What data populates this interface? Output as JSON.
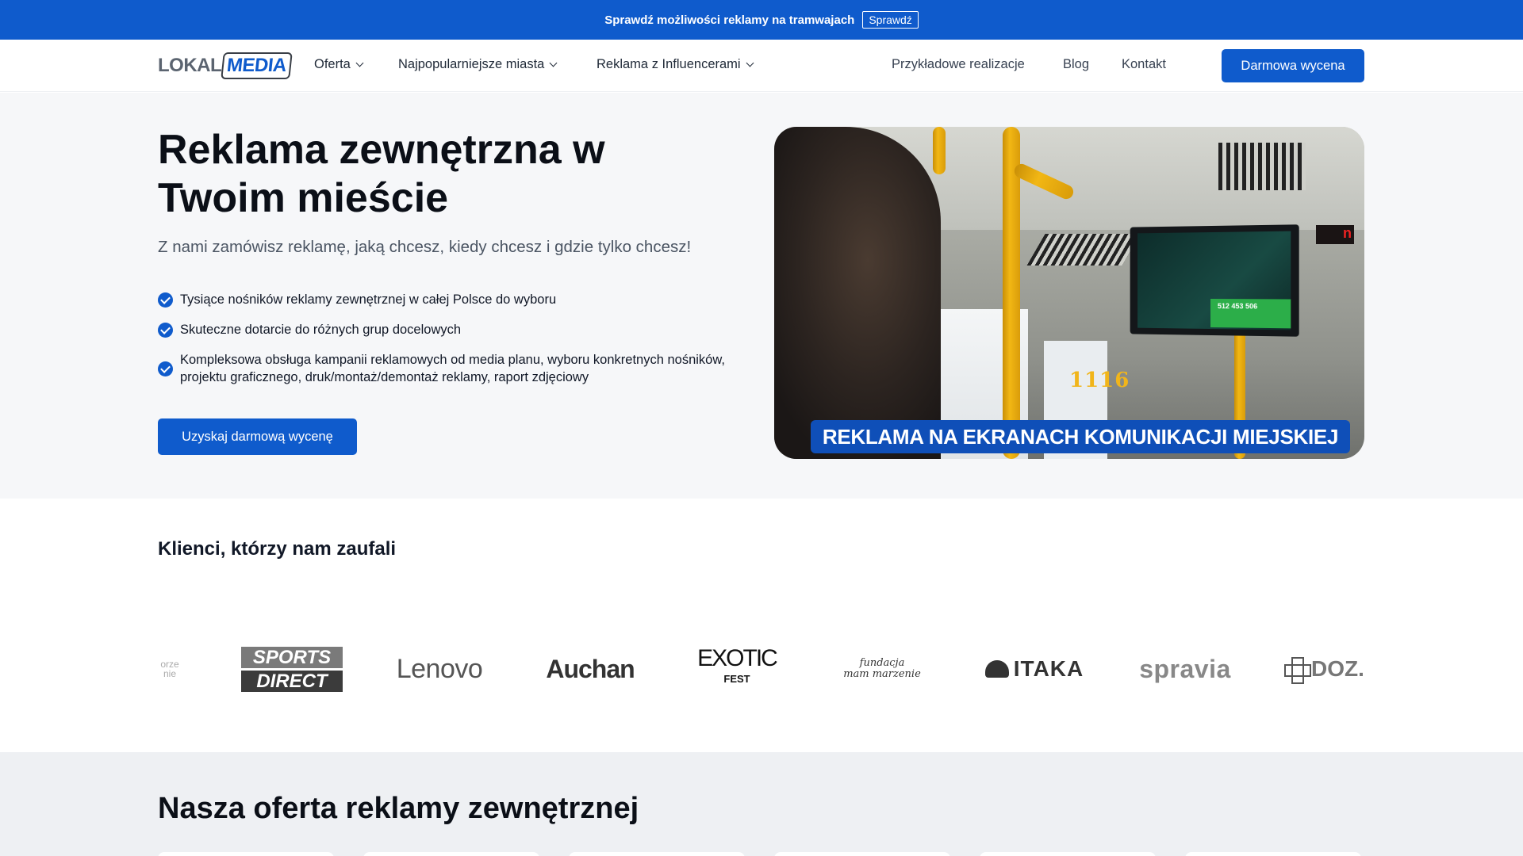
{
  "promo": {
    "text": "Sprawdź możliwości reklamy na tramwajach",
    "button": "Sprawdź"
  },
  "nav": {
    "logo": {
      "part1": "LOKAL",
      "part2": "MEDIA"
    },
    "menus": [
      {
        "label": "Oferta"
      },
      {
        "label": "Najpopularniejsze miasta"
      },
      {
        "label": "Reklama z Influencerami"
      }
    ],
    "links": [
      {
        "label": "Przykładowe realizacje"
      },
      {
        "label": "Blog"
      },
      {
        "label": "Kontakt"
      }
    ],
    "cta": "Darmowa wycena"
  },
  "hero": {
    "title": "Reklama zewnętrzna w Twoim mieście",
    "subtitle": "Z nami zamówisz reklamę, jaką chcesz, kiedy chcesz i gdzie tylko chcesz!",
    "features": [
      "Tysiące nośników reklamy zewnętrznej w całej Polsce do wyboru",
      "Skuteczne dotarcie do różnych grup docelowych",
      "Kompleksowa obsługa kampanii reklamowych od media planu, wyboru konkretnych nośników, projektu graficznego, druk/montaż/demontaż reklamy, raport zdjęciowy"
    ],
    "button": "Uzyskaj darmową wycenę",
    "image": {
      "caption": "REKLAMA NA EKRANACH KOMUNIKACJI MIEJSKIEJ",
      "bus_number": "1116",
      "screen_phone": "512 453 506"
    }
  },
  "clients": {
    "title": "Klienci, którzy nam zaufali",
    "logos": {
      "partial": [
        "orze",
        "nie"
      ],
      "sports_direct": [
        "SPORTS",
        "DIRECT"
      ],
      "lenovo": "Lenovo",
      "auchan": "Auchan",
      "exotic": [
        "EXOTIC",
        "FEST"
      ],
      "fundacja": [
        "fundacja",
        "mam marzenie"
      ],
      "itaka": "ITAKA",
      "spravia": "spravia",
      "doz": "DOZ."
    }
  },
  "offer": {
    "title": "Nasza oferta reklamy zewnętrznej"
  },
  "colors": {
    "brand": "#0f5bcc",
    "hero_bg": "#f6f7f9",
    "offer_bg": "#eef0f3"
  }
}
